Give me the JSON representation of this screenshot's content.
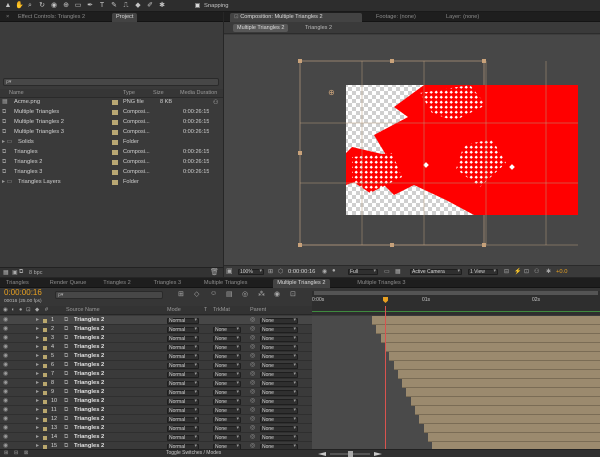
{
  "toolbar": {
    "snapping_label": "Snapping"
  },
  "left_tabs": [
    "Effect Controls: Triangles 2",
    "Project"
  ],
  "project": {
    "search_placeholder": "ρ▾",
    "columns": [
      "Name",
      "Type",
      "Size",
      "Media Duration"
    ],
    "items": [
      {
        "name": "Acme.png",
        "type": "PNG file",
        "size": "8 KB",
        "duration": "",
        "kind": "image",
        "indent": 0
      },
      {
        "name": "Multiple Triangles",
        "type": "Composi...",
        "size": "",
        "duration": "0:00:26:15",
        "kind": "comp",
        "indent": 0
      },
      {
        "name": "Multiple Triangles 2",
        "type": "Composi...",
        "size": "",
        "duration": "0:00:26:15",
        "kind": "comp",
        "indent": 0
      },
      {
        "name": "Multiple Triangles 3",
        "type": "Composi...",
        "size": "",
        "duration": "0:00:26:15",
        "kind": "comp",
        "indent": 0
      },
      {
        "name": "Solids",
        "type": "Folder",
        "size": "",
        "duration": "",
        "kind": "folder",
        "indent": 0
      },
      {
        "name": "Triangles",
        "type": "Composi...",
        "size": "",
        "duration": "0:00:26:15",
        "kind": "comp",
        "indent": 0
      },
      {
        "name": "Triangles 2",
        "type": "Composi...",
        "size": "",
        "duration": "0:00:26:15",
        "kind": "comp",
        "indent": 0
      },
      {
        "name": "Triangles 3",
        "type": "Composi...",
        "size": "",
        "duration": "0:00:26:15",
        "kind": "comp",
        "indent": 0
      },
      {
        "name": "Triangles Layers",
        "type": "Folder",
        "size": "",
        "duration": "",
        "kind": "folder",
        "indent": 0
      }
    ],
    "footer_bpc": "8 bpc"
  },
  "comp_panel": {
    "tabs": [
      "Composition: Multiple Triangles 2",
      "Footage: (none)",
      "Layer: (none)"
    ],
    "subtabs": [
      "Multiple Triangles 2",
      "Triangles 2"
    ],
    "zoom": "100%",
    "timecode": "0:00:00:16",
    "resolution": "Full",
    "camera": "Active Camera",
    "views": "1 View",
    "exposure": "+0.0"
  },
  "timeline": {
    "tabs": [
      "Triangles",
      "Render Queue",
      "Triangles 2",
      "Triangles 3",
      "Multiple Triangles",
      "Multiple Triangles 2",
      "Multiple Triangles 3"
    ],
    "active_tab": "Multiple Triangles 2",
    "timecode": "0:00:00:16",
    "fps": "00016 (25.00 fps)",
    "columns": {
      "source": "Source Name",
      "mode": "Mode",
      "t": "T",
      "trkmat": "TrkMat",
      "parent": "Parent"
    },
    "ruler": [
      "0:00s",
      "01s",
      "02s"
    ],
    "layers": [
      {
        "num": "1",
        "name": "Triangles 2",
        "mode": "Normal",
        "trkmat": "",
        "parent": "None"
      },
      {
        "num": "2",
        "name": "Triangles 2",
        "mode": "Normal",
        "trkmat": "None",
        "parent": "None"
      },
      {
        "num": "3",
        "name": "Triangles 2",
        "mode": "Normal",
        "trkmat": "None",
        "parent": "None"
      },
      {
        "num": "4",
        "name": "Triangles 2",
        "mode": "Normal",
        "trkmat": "None",
        "parent": "None"
      },
      {
        "num": "5",
        "name": "Triangles 2",
        "mode": "Normal",
        "trkmat": "None",
        "parent": "None"
      },
      {
        "num": "6",
        "name": "Triangles 2",
        "mode": "Normal",
        "trkmat": "None",
        "parent": "None"
      },
      {
        "num": "7",
        "name": "Triangles 2",
        "mode": "Normal",
        "trkmat": "None",
        "parent": "None"
      },
      {
        "num": "8",
        "name": "Triangles 2",
        "mode": "Normal",
        "trkmat": "None",
        "parent": "None"
      },
      {
        "num": "9",
        "name": "Triangles 2",
        "mode": "Normal",
        "trkmat": "None",
        "parent": "None"
      },
      {
        "num": "10",
        "name": "Triangles 2",
        "mode": "Normal",
        "trkmat": "None",
        "parent": "None"
      },
      {
        "num": "11",
        "name": "Triangles 2",
        "mode": "Normal",
        "trkmat": "None",
        "parent": "None"
      },
      {
        "num": "12",
        "name": "Triangles 2",
        "mode": "Normal",
        "trkmat": "None",
        "parent": "None"
      },
      {
        "num": "13",
        "name": "Triangles 2",
        "mode": "Normal",
        "trkmat": "None",
        "parent": "None"
      },
      {
        "num": "14",
        "name": "Triangles 2",
        "mode": "Normal",
        "trkmat": "None",
        "parent": "None"
      },
      {
        "num": "15",
        "name": "Triangles 2",
        "mode": "Normal",
        "trkmat": "None",
        "parent": "None"
      }
    ],
    "footer_label": "Toggle Switches / Modes"
  },
  "colors": {
    "accent_orange": "#e8a020",
    "bar": "#9b8a6e",
    "playhead": "#d9534f",
    "red": "#ff0000"
  }
}
